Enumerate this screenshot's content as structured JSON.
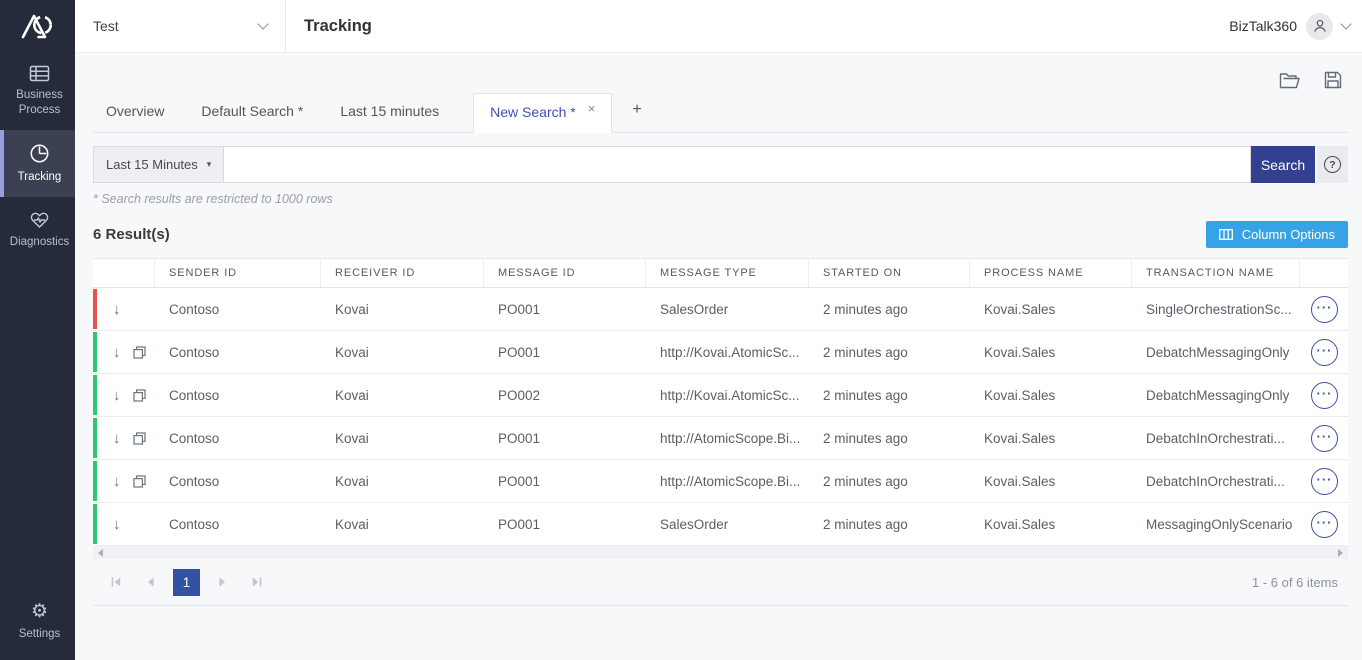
{
  "colors": {
    "accent_indigo": "#333f90",
    "pager_indigo": "#3452a4",
    "azure": "#35a3e5",
    "tab_active_blue": "#3f51b5",
    "status_error": "#e8544a",
    "status_success": "#2dc96f",
    "sidebar_bg": "#262b3b",
    "sidebar_active_bg": "#3b4153",
    "sidebar_accent": "#97a0dc"
  },
  "topbar": {
    "environment": "Test",
    "title": "Tracking",
    "user_name": "BizTalk360"
  },
  "sidebar": {
    "items": [
      {
        "label": "Business Process",
        "icon": "business-process-icon"
      },
      {
        "label": "Tracking",
        "icon": "tracking-icon"
      },
      {
        "label": "Diagnostics",
        "icon": "diagnostics-icon"
      }
    ],
    "settings_label": "Settings",
    "settings_glyph": "⚙"
  },
  "tabs": {
    "items": [
      {
        "label": "Overview"
      },
      {
        "label": "Default Search *"
      },
      {
        "label": "Last 15 minutes"
      },
      {
        "label": "New Search *"
      }
    ],
    "close_glyph": "×",
    "add_glyph": "+"
  },
  "search": {
    "time_filter_label": "Last 15 Minutes",
    "time_filter_caret": "▾",
    "query_value": "",
    "button_label": "Search",
    "help_glyph": "?",
    "note": "* Search results are restricted to 1000 rows"
  },
  "results": {
    "count_label": "6 Result(s)",
    "column_options_label": "Column Options"
  },
  "table": {
    "columns": [
      "SENDER ID",
      "RECEIVER ID",
      "MESSAGE ID",
      "MESSAGE TYPE",
      "STARTED ON",
      "PROCESS NAME",
      "TRANSACTION NAME"
    ],
    "row_expand_glyph": "↓",
    "actions_glyph": "···",
    "rows": [
      {
        "status": "error",
        "has_copy": false,
        "sender_id": "Contoso",
        "receiver_id": "Kovai",
        "message_id": "PO001",
        "message_type": "SalesOrder",
        "started_on": "2 minutes ago",
        "process_name": "Kovai.Sales",
        "transaction_name": "SingleOrchestrationSc..."
      },
      {
        "status": "success",
        "has_copy": true,
        "sender_id": "Contoso",
        "receiver_id": "Kovai",
        "message_id": "PO001",
        "message_type": "http://Kovai.AtomicSc...",
        "started_on": "2 minutes ago",
        "process_name": "Kovai.Sales",
        "transaction_name": "DebatchMessagingOnly"
      },
      {
        "status": "success",
        "has_copy": true,
        "sender_id": "Contoso",
        "receiver_id": "Kovai",
        "message_id": "PO002",
        "message_type": "http://Kovai.AtomicSc...",
        "started_on": "2 minutes ago",
        "process_name": "Kovai.Sales",
        "transaction_name": "DebatchMessagingOnly"
      },
      {
        "status": "success",
        "has_copy": true,
        "sender_id": "Contoso",
        "receiver_id": "Kovai",
        "message_id": "PO001",
        "message_type": "http://AtomicScope.Bi...",
        "started_on": "2 minutes ago",
        "process_name": "Kovai.Sales",
        "transaction_name": "DebatchInOrchestrati..."
      },
      {
        "status": "success",
        "has_copy": true,
        "sender_id": "Contoso",
        "receiver_id": "Kovai",
        "message_id": "PO001",
        "message_type": "http://AtomicScope.Bi...",
        "started_on": "2 minutes ago",
        "process_name": "Kovai.Sales",
        "transaction_name": "DebatchInOrchestrati..."
      },
      {
        "status": "success",
        "has_copy": false,
        "sender_id": "Contoso",
        "receiver_id": "Kovai",
        "message_id": "PO001",
        "message_type": "SalesOrder",
        "started_on": "2 minutes ago",
        "process_name": "Kovai.Sales",
        "transaction_name": "MessagingOnlyScenario"
      }
    ]
  },
  "pagination": {
    "current_page": "1",
    "range_label": "1 - 6 of 6 items"
  }
}
